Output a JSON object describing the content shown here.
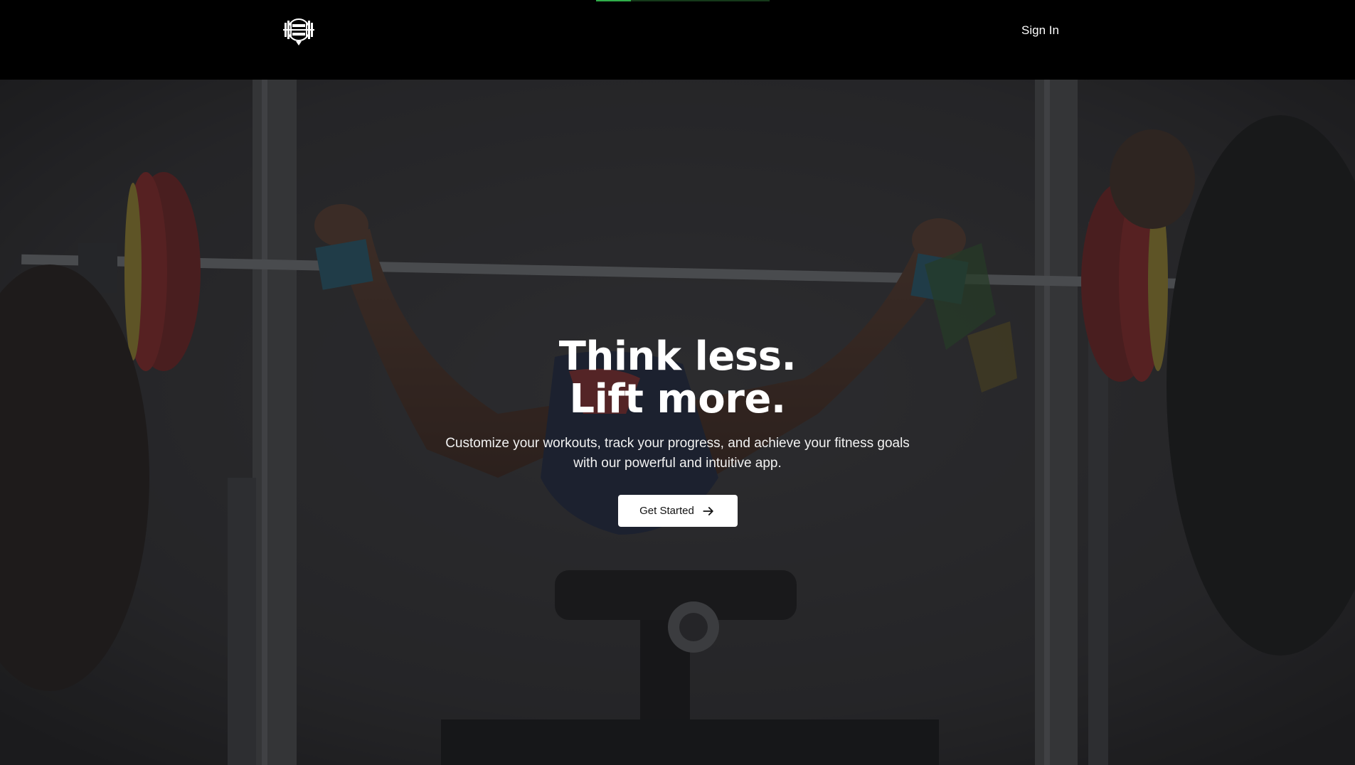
{
  "loading": {
    "progress": 0.2,
    "track_color": "#15391a",
    "fill_color": "#2fae4a"
  },
  "nav": {
    "logo_icon": "barbell-globe-icon",
    "signin_label": "Sign In"
  },
  "hero": {
    "headline_line1": "Think less.",
    "headline_line2": "Lift more.",
    "subtext_line1": "Customize your workouts, track your progress, and achieve your fitness goals",
    "subtext_line2": "with our powerful and intuitive app.",
    "cta_label": "Get Started",
    "cta_icon": "arrow-right-icon",
    "background_image": "bench-press-lifter-photo"
  },
  "colors": {
    "nav_background": "#000000",
    "text": "#ffffff",
    "cta_background": "#ffffff",
    "cta_text": "#111111"
  }
}
